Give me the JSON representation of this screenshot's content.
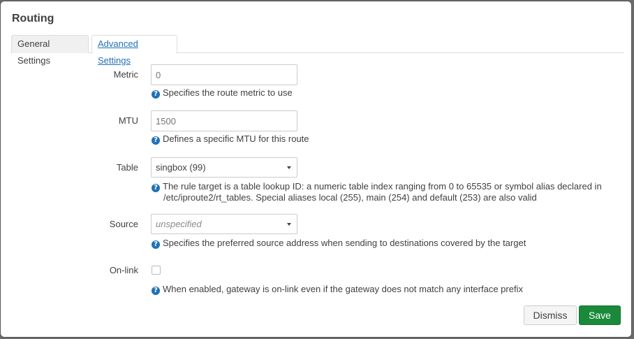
{
  "dialog": {
    "title": "Routing"
  },
  "tabs": [
    {
      "label": "General Settings",
      "active": false
    },
    {
      "label": "Advanced Settings",
      "active": true
    }
  ],
  "fields": {
    "metric": {
      "label": "Metric",
      "placeholder": "0",
      "help": "Specifies the route metric to use"
    },
    "mtu": {
      "label": "MTU",
      "placeholder": "1500",
      "help": "Defines a specific MTU for this route"
    },
    "table": {
      "label": "Table",
      "value": "singbox (99)",
      "help_line1": "The rule target is a table lookup ID: a numeric table index ranging from 0 to 65535 or symbol alias declared in",
      "help_line2": "/etc/iproute2/rt_tables. Special aliases local (255), main (254) and default (253) are also valid"
    },
    "source": {
      "label": "Source",
      "value": "unspecified",
      "help": "Specifies the preferred source address when sending to destinations covered by the target"
    },
    "onlink": {
      "label": "On-link",
      "checked": false,
      "help": "When enabled, gateway is on-link even if the gateway does not match any interface prefix"
    }
  },
  "help_icon_glyph": "?",
  "buttons": {
    "dismiss": "Dismiss",
    "save": "Save"
  },
  "colors": {
    "accent": "#1f71b8",
    "save": "#1a8a3a"
  }
}
